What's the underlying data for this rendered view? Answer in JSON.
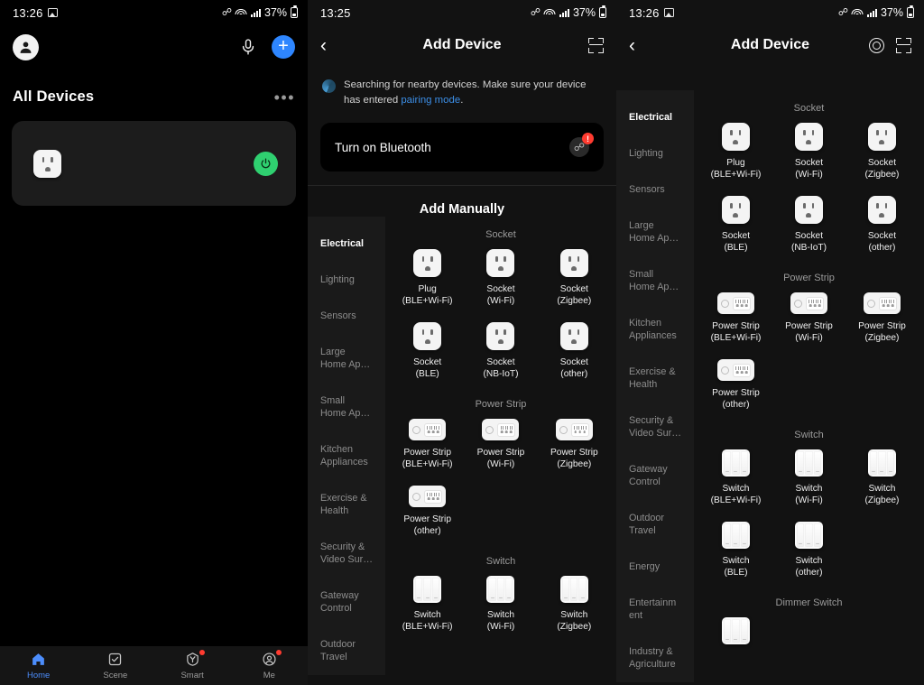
{
  "panel1": {
    "statusbar": {
      "time": "13:26",
      "battery": "37%",
      "icons": [
        "gallery-icon",
        "bluetooth-icon",
        "wifi-icon",
        "signal-icon",
        "battery-icon"
      ]
    },
    "header": {
      "avatar": "user-avatar",
      "mic": "microphone-icon",
      "add": "+"
    },
    "section": {
      "title": "All Devices",
      "more": "•••"
    },
    "device_card": {
      "icon": "smart-plug-icon",
      "power_state": "on",
      "power_color": "#2fd070"
    },
    "tabs": [
      {
        "label": "Home",
        "icon": "home-icon",
        "active": true,
        "badge": false
      },
      {
        "label": "Scene",
        "icon": "scene-icon",
        "active": false,
        "badge": false
      },
      {
        "label": "Smart",
        "icon": "smart-icon",
        "active": false,
        "badge": true
      },
      {
        "label": "Me",
        "icon": "profile-icon",
        "active": false,
        "badge": true
      }
    ]
  },
  "panel2": {
    "statusbar": {
      "time": "13:25",
      "battery": "37%"
    },
    "header": {
      "back": "‹",
      "title": "Add Device",
      "scan": "scan-qr-icon"
    },
    "searching": {
      "text_before": "Searching for nearby devices. Make sure your device has entered ",
      "link": "pairing mode",
      "text_after": "."
    },
    "bluetooth_card": {
      "title": "Turn on Bluetooth",
      "badge": "!"
    },
    "add_manually": "Add Manually",
    "categories": [
      "Electrical",
      "Lighting",
      "Sensors",
      "Large\nHome Ap…",
      "Small\nHome Ap…",
      "Kitchen\nAppliances",
      "Exercise &\nHealth",
      "Security &\nVideo Sur…",
      "Gateway\nControl",
      "Outdoor\nTravel"
    ],
    "active_category": "Electrical",
    "groups": [
      {
        "title": "Socket",
        "products": [
          {
            "label": "Plug\n(BLE+Wi-Fi)",
            "icon": "socket"
          },
          {
            "label": "Socket\n(Wi-Fi)",
            "icon": "socket"
          },
          {
            "label": "Socket\n(Zigbee)",
            "icon": "socket"
          },
          {
            "label": "Socket\n(BLE)",
            "icon": "socket"
          },
          {
            "label": "Socket\n(NB-IoT)",
            "icon": "socket"
          },
          {
            "label": "Socket\n(other)",
            "icon": "socket"
          }
        ]
      },
      {
        "title": "Power Strip",
        "products": [
          {
            "label": "Power Strip\n(BLE+Wi-Fi)",
            "icon": "strip"
          },
          {
            "label": "Power Strip\n(Wi-Fi)",
            "icon": "strip"
          },
          {
            "label": "Power Strip\n(Zigbee)",
            "icon": "strip"
          },
          {
            "label": "Power Strip\n(other)",
            "icon": "strip"
          }
        ]
      },
      {
        "title": "Switch",
        "products": [
          {
            "label": "Switch\n(BLE+Wi-Fi)",
            "icon": "switch"
          },
          {
            "label": "Switch\n(Wi-Fi)",
            "icon": "switch"
          },
          {
            "label": "Switch\n(Zigbee)",
            "icon": "switch"
          }
        ]
      }
    ]
  },
  "panel3": {
    "statusbar": {
      "time": "13:26",
      "battery": "37%"
    },
    "header": {
      "back": "‹",
      "title": "Add Device",
      "target": "target-icon",
      "scan": "scan-qr-icon"
    },
    "categories": [
      "Electrical",
      "Lighting",
      "Sensors",
      "Large\nHome Ap…",
      "Small\nHome Ap…",
      "Kitchen\nAppliances",
      "Exercise &\nHealth",
      "Security &\nVideo Sur…",
      "Gateway\nControl",
      "Outdoor\nTravel",
      "Energy",
      "Entertainm\nent",
      "Industry &\nAgriculture"
    ],
    "active_category": "Electrical",
    "groups": [
      {
        "title": "Socket",
        "products": [
          {
            "label": "Plug\n(BLE+Wi-Fi)",
            "icon": "socket"
          },
          {
            "label": "Socket\n(Wi-Fi)",
            "icon": "socket"
          },
          {
            "label": "Socket\n(Zigbee)",
            "icon": "socket"
          },
          {
            "label": "Socket\n(BLE)",
            "icon": "socket"
          },
          {
            "label": "Socket\n(NB-IoT)",
            "icon": "socket"
          },
          {
            "label": "Socket\n(other)",
            "icon": "socket"
          }
        ]
      },
      {
        "title": "Power Strip",
        "products": [
          {
            "label": "Power Strip\n(BLE+Wi-Fi)",
            "icon": "strip"
          },
          {
            "label": "Power Strip\n(Wi-Fi)",
            "icon": "strip"
          },
          {
            "label": "Power Strip\n(Zigbee)",
            "icon": "strip"
          },
          {
            "label": "Power Strip\n(other)",
            "icon": "strip"
          }
        ]
      },
      {
        "title": "Switch",
        "products": [
          {
            "label": "Switch\n(BLE+Wi-Fi)",
            "icon": "switch"
          },
          {
            "label": "Switch\n(Wi-Fi)",
            "icon": "switch"
          },
          {
            "label": "Switch\n(Zigbee)",
            "icon": "switch"
          },
          {
            "label": "Switch\n(BLE)",
            "icon": "switch"
          },
          {
            "label": "Switch\n(other)",
            "icon": "switch"
          }
        ]
      },
      {
        "title": "Dimmer Switch",
        "products": [
          {
            "label": "",
            "icon": "switch"
          }
        ]
      }
    ]
  }
}
